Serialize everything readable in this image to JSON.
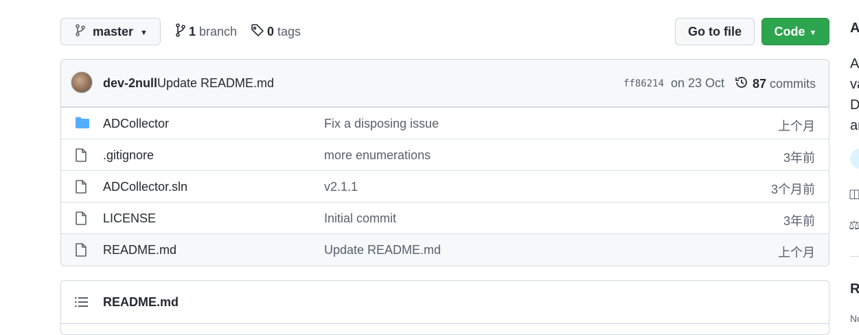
{
  "toolbar": {
    "branch_label": "master",
    "branch_count": "1",
    "branch_word": "branch",
    "tag_count": "0",
    "tag_word": "tags",
    "goto_label": "Go to file",
    "code_label": "Code"
  },
  "latest_commit": {
    "author": "dev-2null",
    "message": "Update README.md",
    "sha": "ff86214",
    "date": "on 23 Oct",
    "commit_count": "87",
    "commit_word": "commits"
  },
  "files": [
    {
      "type": "folder",
      "name": "ADCollector",
      "message": "Fix a disposing issue",
      "age": "上个月"
    },
    {
      "type": "file",
      "name": ".gitignore",
      "message": "more enumerations",
      "age": "3年前"
    },
    {
      "type": "file",
      "name": "ADCollector.sln",
      "message": "v2.1.1",
      "age": "3个月前"
    },
    {
      "type": "file",
      "name": "LICENSE",
      "message": "Initial commit",
      "age": "3年前"
    },
    {
      "type": "file",
      "name": "README.md",
      "message": "Update README.md",
      "age": "上个月"
    }
  ],
  "readme": {
    "title": "README.md"
  },
  "sidebar_clipped": {
    "about_head": "A",
    "about_lines": [
      "A",
      "va",
      "D",
      "ar"
    ],
    "icon_a": "◫",
    "icon_b": "⚖",
    "releases_head": "R",
    "releases_sub": "No"
  },
  "colors": {
    "accent_green": "#2da44e",
    "folder_blue": "#54aeff",
    "muted": "#57606a"
  }
}
